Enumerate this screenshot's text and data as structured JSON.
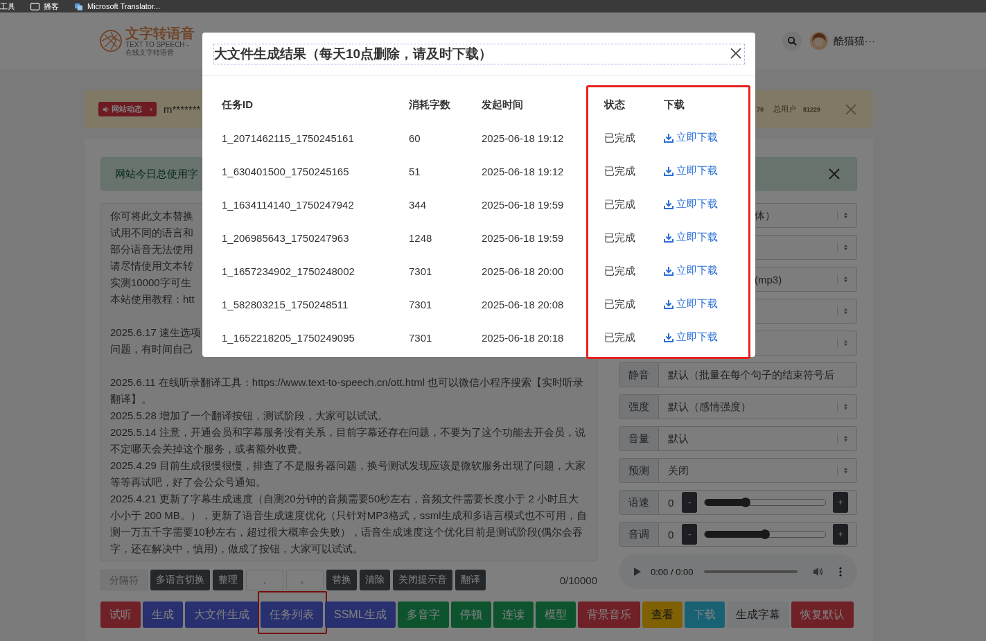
{
  "bookmarks_bar": {
    "items": [
      {
        "label": "工具",
        "kind": "text"
      },
      {
        "label": "播客",
        "kind": "folder"
      },
      {
        "label": "Microsoft Translator...",
        "kind": "app"
      }
    ]
  },
  "header": {
    "logo_title": "文字转语音",
    "logo_subtitle": "TEXT TO SPEECH - 在线文字转语音",
    "user_name": "酷猫猫···"
  },
  "notice": {
    "badge": "网站动态",
    "message": "m*******",
    "stat_tail": "70",
    "users_label": "总用户",
    "users_count": "81229"
  },
  "alert": {
    "text": "网站今日总使用字"
  },
  "editor": {
    "covered_groups": [
      [
        "你可将此文本替换",
        "试用不同的语言和",
        "部分语音无法使用",
        "请尽情使用文本转",
        "实测10000字可生",
        "本站使用教程：htt"
      ],
      [
        "2025.6.17 速生选项",
        "问题，有时间自己"
      ]
    ],
    "paragraphs": [
      "2025.6.11 在线听录翻译工具：https://www.text-to-speech.cn/ott.html 也可以微信小程序搜索【实时听录翻译】。",
      "2025.5.28 增加了一个翻译按钮，测试阶段，大家可以试试。",
      "2025.5.14 注意，开通会员和字幕服务没有关系，目前字幕还存在问题，不要为了这个功能去开会员，说不定哪天会关掉这个服务，或者额外收费。",
      "2025.4.29 目前生成很慢很慢，排查了不是服务器问题，换号测试发现应该是微软服务出现了问题，大家等等再试吧，好了会公众号通知。",
      "2025.4.21 更新了字幕生成速度（自测20分钟的音频需要50秒左右，音频文件需要长度小于 2 小时且大小小于 200 MB。），更新了语音生成速度优化（只针对MP3格式，ssml生成和多语言模式也不可用，自测一万五千字需要10秒左右，超过很大概率会失败），语音生成速度这个优化目前是测试阶段(偶尔会吞字，还在解决中，慎用)，做成了按钮，大家可以试试。"
    ],
    "counter": "0/10000"
  },
  "settings": [
    {
      "kind": "select",
      "value": "体）"
    },
    {
      "kind": "select"
    },
    {
      "kind": "select",
      "value": "(mp3)"
    },
    {
      "kind": "select"
    },
    {
      "kind": "select"
    },
    {
      "kind": "input",
      "label": "静音",
      "value": "默认（批量在每个句子的结束符号后"
    },
    {
      "kind": "select",
      "label": "强度",
      "value": "默认（感情强度）"
    },
    {
      "kind": "select",
      "label": "音量",
      "value": "默认"
    },
    {
      "kind": "select",
      "label": "预测",
      "value": "关闭"
    },
    {
      "kind": "slider",
      "label": "语速",
      "value": "0",
      "minus": "-",
      "plus": "+",
      "level": 0.34
    },
    {
      "kind": "slider",
      "label": "音调",
      "value": "0",
      "minus": "-",
      "plus": "+",
      "level": 0.5
    }
  ],
  "player": {
    "time": "0:00 / 0:00"
  },
  "tools": [
    {
      "kind": "label",
      "text": "分隔符"
    },
    {
      "kind": "button",
      "text": "多语言切换"
    },
    {
      "kind": "button",
      "text": "整理"
    },
    {
      "kind": "input",
      "text": "."
    },
    {
      "kind": "input",
      "text": "。"
    },
    {
      "kind": "button",
      "text": "替换"
    },
    {
      "kind": "button",
      "text": "清除"
    },
    {
      "kind": "button",
      "text": "关闭提示音"
    },
    {
      "kind": "button",
      "text": "翻译"
    }
  ],
  "actions": [
    {
      "label": "试听",
      "kind": "danger",
      "highlighted": false
    },
    {
      "label": "生成",
      "kind": "primary",
      "highlighted": false
    },
    {
      "label": "大文件生成",
      "kind": "primary",
      "highlighted": false
    },
    {
      "label": "任务列表",
      "kind": "primary",
      "highlighted": true
    },
    {
      "label": "SSML生成",
      "kind": "primary",
      "highlighted": false
    },
    {
      "label": "多音字",
      "kind": "success",
      "highlighted": false
    },
    {
      "label": "停顿",
      "kind": "success",
      "highlighted": false
    },
    {
      "label": "连读",
      "kind": "success",
      "highlighted": false
    },
    {
      "label": "模型",
      "kind": "success",
      "highlighted": false
    },
    {
      "label": "背景音乐",
      "kind": "danger",
      "highlighted": false
    },
    {
      "label": "查看",
      "kind": "warning",
      "highlighted": false
    },
    {
      "label": "下载",
      "kind": "info",
      "highlighted": false
    },
    {
      "label": "生成字幕",
      "kind": "light",
      "highlighted": false
    },
    {
      "label": "恢复默认",
      "kind": "danger",
      "highlighted": false
    }
  ],
  "modal": {
    "title": "大文件生成结果（每天10点删除，请及时下载）",
    "columns": [
      {
        "label": "任务ID",
        "highlighted": false
      },
      {
        "label": "消耗字数",
        "highlighted": false
      },
      {
        "label": "发起时间",
        "highlighted": false
      },
      {
        "label": "状态",
        "highlighted": true
      },
      {
        "label": "下载",
        "highlighted": true
      }
    ],
    "rows": [
      [
        "1_2071462115_1750245161",
        "60",
        "2025-06-18 19:12",
        "已完成",
        "立即下载"
      ],
      [
        "1_630401500_1750245165",
        "51",
        "2025-06-18 19:12",
        "已完成",
        "立即下载"
      ],
      [
        "1_1634114140_1750247942",
        "344",
        "2025-06-18 19:59",
        "已完成",
        "立即下载"
      ],
      [
        "1_206985643_1750247963",
        "1248",
        "2025-06-18 19:59",
        "已完成",
        "立即下载"
      ],
      [
        "1_1657234902_1750248002",
        "7301",
        "2025-06-18 20:00",
        "已完成",
        "立即下载"
      ],
      [
        "1_582803215_1750248511",
        "7301",
        "2025-06-18 20:08",
        "已完成",
        "立即下载"
      ],
      [
        "1_1652218205_1750249095",
        "7301",
        "2025-06-18 20:18",
        "已完成",
        "立即下载"
      ]
    ]
  }
}
